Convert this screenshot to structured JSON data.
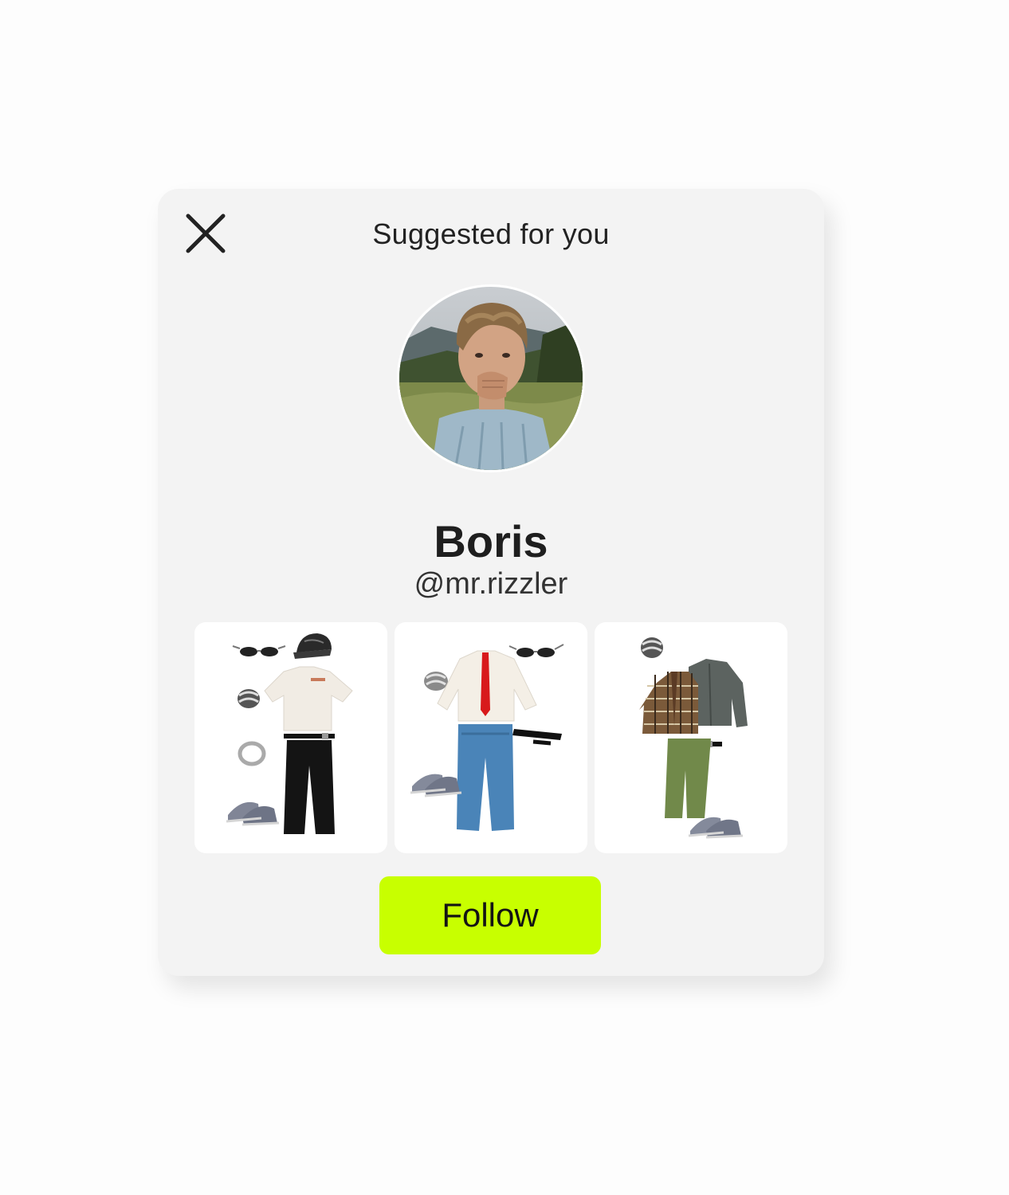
{
  "header": {
    "title": "Suggested for you",
    "close_icon": "close-icon"
  },
  "profile": {
    "display_name": "Boris",
    "username": "@mr.rizzler",
    "avatar": "profile-photo"
  },
  "outfits": [
    {
      "name": "outfit-1",
      "items": [
        "sunglasses",
        "cap",
        "ring",
        "ring",
        "white t-shirt",
        "belt",
        "black trousers",
        "sneakers"
      ]
    },
    {
      "name": "outfit-2",
      "items": [
        "ring",
        "white shirt",
        "red tie",
        "sunglasses",
        "belt",
        "blue jeans",
        "sneakers"
      ]
    },
    {
      "name": "outfit-3",
      "items": [
        "ring",
        "plaid shirt",
        "grey jacket",
        "belt",
        "green trousers",
        "sneakers"
      ]
    }
  ],
  "actions": {
    "follow_label": "Follow"
  },
  "colors": {
    "accent": "#c8ff00",
    "card_background": "#f3f3f3",
    "text": "#1e1e1e"
  }
}
